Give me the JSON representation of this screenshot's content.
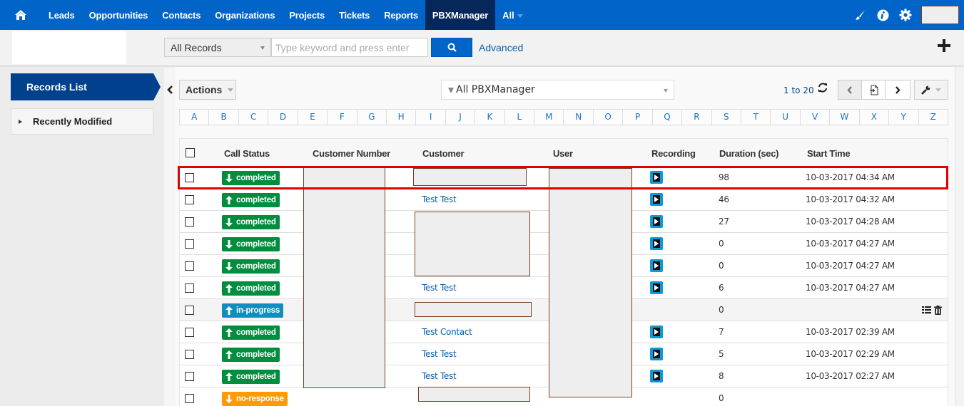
{
  "topnav": {
    "home_icon": "home-icon",
    "items": [
      {
        "label": "Leads",
        "active": false
      },
      {
        "label": "Opportunities",
        "active": false
      },
      {
        "label": "Contacts",
        "active": false
      },
      {
        "label": "Organizations",
        "active": false
      },
      {
        "label": "Projects",
        "active": false
      },
      {
        "label": "Tickets",
        "active": false
      },
      {
        "label": "Reports",
        "active": false
      },
      {
        "label": "PBXManager",
        "active": true
      }
    ],
    "all_label": "All",
    "right_icons": [
      "paintbrush-icon",
      "info-icon",
      "gear-icon"
    ]
  },
  "search": {
    "scope_selected": "All Records",
    "placeholder": "Type keyword and press enter",
    "search_icon": "search-icon",
    "advanced_label": "Advanced",
    "add_icon": "plus-icon"
  },
  "sidebar": {
    "records_list_label": "Records List",
    "recently_modified_label": "Recently Modified"
  },
  "toolbar": {
    "actions_label": "Actions",
    "filter_selected": "All PBXManager",
    "page_info": "1 to 20",
    "refresh_icon": "refresh-icon",
    "prev_icon": "chevron-left-icon",
    "export_icon": "page-jump-icon",
    "next_icon": "chevron-right-icon",
    "tools_icon": "wrench-icon"
  },
  "alphabet": [
    "A",
    "B",
    "C",
    "D",
    "E",
    "F",
    "G",
    "H",
    "I",
    "J",
    "K",
    "L",
    "M",
    "N",
    "O",
    "P",
    "Q",
    "R",
    "S",
    "T",
    "U",
    "V",
    "W",
    "X",
    "Y",
    "Z"
  ],
  "table": {
    "columns": [
      "Call Status",
      "Customer Number",
      "Customer",
      "User",
      "Recording",
      "Duration (sec)",
      "Start Time"
    ],
    "rows": [
      {
        "direction": "down",
        "status": "completed",
        "customer": "",
        "recording": true,
        "duration": "98",
        "start_time": "10-03-2017 04:34 AM"
      },
      {
        "direction": "up",
        "status": "completed",
        "customer": "Test Test",
        "recording": true,
        "duration": "46",
        "start_time": "10-03-2017 04:32 AM"
      },
      {
        "direction": "down",
        "status": "completed",
        "customer": "",
        "recording": true,
        "duration": "27",
        "start_time": "10-03-2017 04:28 AM"
      },
      {
        "direction": "down",
        "status": "completed",
        "customer": "",
        "recording": true,
        "duration": "0",
        "start_time": "10-03-2017 04:27 AM"
      },
      {
        "direction": "down",
        "status": "completed",
        "customer": "",
        "recording": true,
        "duration": "0",
        "start_time": "10-03-2017 04:27 AM"
      },
      {
        "direction": "up",
        "status": "completed",
        "customer": "Test Test",
        "recording": true,
        "duration": "6",
        "start_time": "10-03-2017 04:27 AM"
      },
      {
        "direction": "up",
        "status": "in-progress",
        "customer": "",
        "recording": false,
        "duration": "0",
        "start_time": ""
      },
      {
        "direction": "up",
        "status": "completed",
        "customer": "Test Contact",
        "recording": true,
        "duration": "7",
        "start_time": "10-03-2017 02:39 AM"
      },
      {
        "direction": "up",
        "status": "completed",
        "customer": "Test Test",
        "recording": true,
        "duration": "5",
        "start_time": "10-03-2017 02:29 AM"
      },
      {
        "direction": "up",
        "status": "completed",
        "customer": "Test Test",
        "recording": true,
        "duration": "8",
        "start_time": "10-03-2017 02:27 AM"
      },
      {
        "direction": "down",
        "status": "no-response",
        "customer": "",
        "recording": false,
        "duration": "0",
        "start_time": ""
      }
    ],
    "hover_row_actions": [
      "list-icon",
      "trash-icon"
    ]
  },
  "colors": {
    "nav_bg": "#0064c8",
    "nav_active": "#06275a",
    "sidebar_tab": "#00418e",
    "status_completed": "#008d3e",
    "status_in_progress": "#0e8fbf",
    "status_no_response": "#ff9a00",
    "recording_icon": "#0e98d8",
    "highlight": "#e00000",
    "link": "#0a5ea8"
  }
}
